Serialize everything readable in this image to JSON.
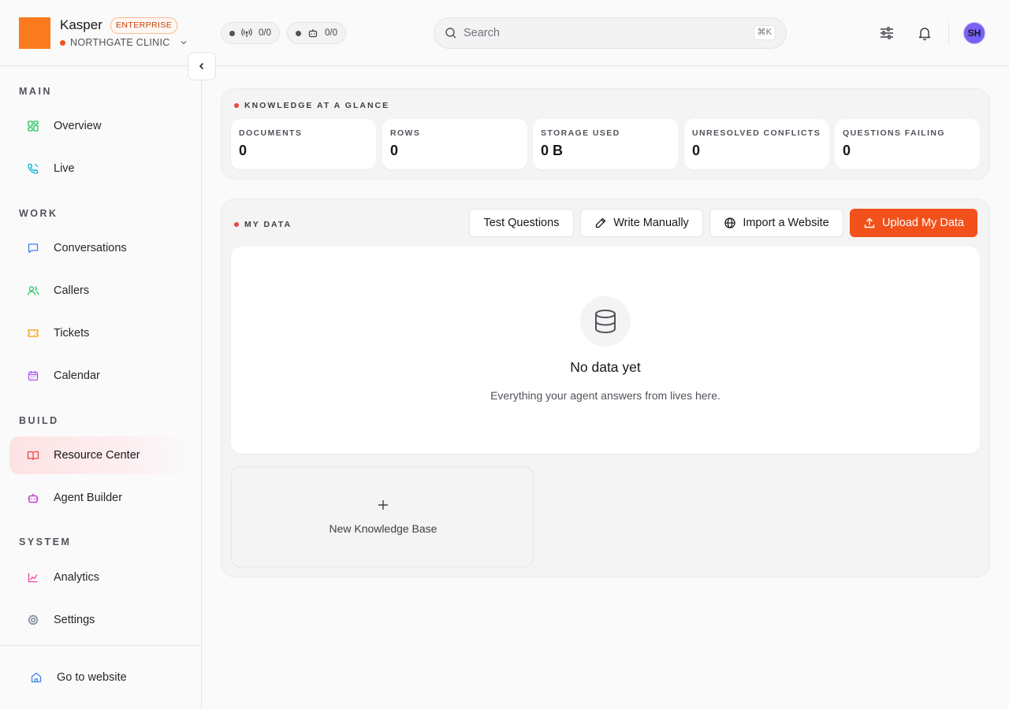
{
  "brand": {
    "name": "Kasper",
    "badge": "ENTERPRISE",
    "org": "NORTHGATE CLINIC"
  },
  "status_pills": [
    {
      "icon": "broadcast-icon",
      "count": "0/0"
    },
    {
      "icon": "bot-icon",
      "count": "0/0"
    }
  ],
  "search": {
    "placeholder": "Search",
    "shortcut": "⌘K"
  },
  "user": {
    "initials": "SH"
  },
  "sidebar": {
    "sections": [
      {
        "label": "MAIN",
        "items": [
          {
            "label": "Overview",
            "icon": "layout-grid-icon",
            "color": "#22c55e"
          },
          {
            "label": "Live",
            "icon": "phone-icon",
            "color": "#06b6d4"
          }
        ]
      },
      {
        "label": "WORK",
        "items": [
          {
            "label": "Conversations",
            "icon": "message-square-icon",
            "color": "#3b82f6"
          },
          {
            "label": "Callers",
            "icon": "users-icon",
            "color": "#22c55e"
          },
          {
            "label": "Tickets",
            "icon": "ticket-icon",
            "color": "#f59e0b"
          },
          {
            "label": "Calendar",
            "icon": "calendar-icon",
            "color": "#a855f7"
          }
        ]
      },
      {
        "label": "BUILD",
        "items": [
          {
            "label": "Resource Center",
            "icon": "book-open-icon",
            "color": "#ef4444",
            "active": true
          },
          {
            "label": "Agent Builder",
            "icon": "bot-icon",
            "color": "#c026d3"
          }
        ]
      },
      {
        "label": "SYSTEM",
        "items": [
          {
            "label": "Analytics",
            "icon": "line-chart-icon",
            "color": "#ec4899"
          },
          {
            "label": "Settings",
            "icon": "gear-icon",
            "color": "#64748b"
          }
        ]
      }
    ],
    "footer": {
      "label": "Go to website",
      "icon": "home-icon",
      "color": "#3b82f6"
    }
  },
  "glance": {
    "title": "KNOWLEDGE AT A GLANCE",
    "stats": [
      {
        "label": "DOCUMENTS",
        "value": "0"
      },
      {
        "label": "ROWS",
        "value": "0"
      },
      {
        "label": "STORAGE USED",
        "value": "0 B"
      },
      {
        "label": "UNRESOLVED CONFLICTS",
        "value": "0"
      },
      {
        "label": "QUESTIONS FAILING",
        "value": "0"
      }
    ]
  },
  "mydata": {
    "title": "MY DATA",
    "buttons": {
      "test": "Test Questions",
      "write": "Write Manually",
      "import": "Import a Website",
      "upload": "Upload My Data"
    },
    "empty": {
      "title": "No data yet",
      "subtitle": "Everything your agent answers from lives here."
    },
    "new_kb": "New Knowledge Base"
  },
  "colors": {
    "accent": "#f2511c",
    "logo": "#fb7a1d"
  }
}
